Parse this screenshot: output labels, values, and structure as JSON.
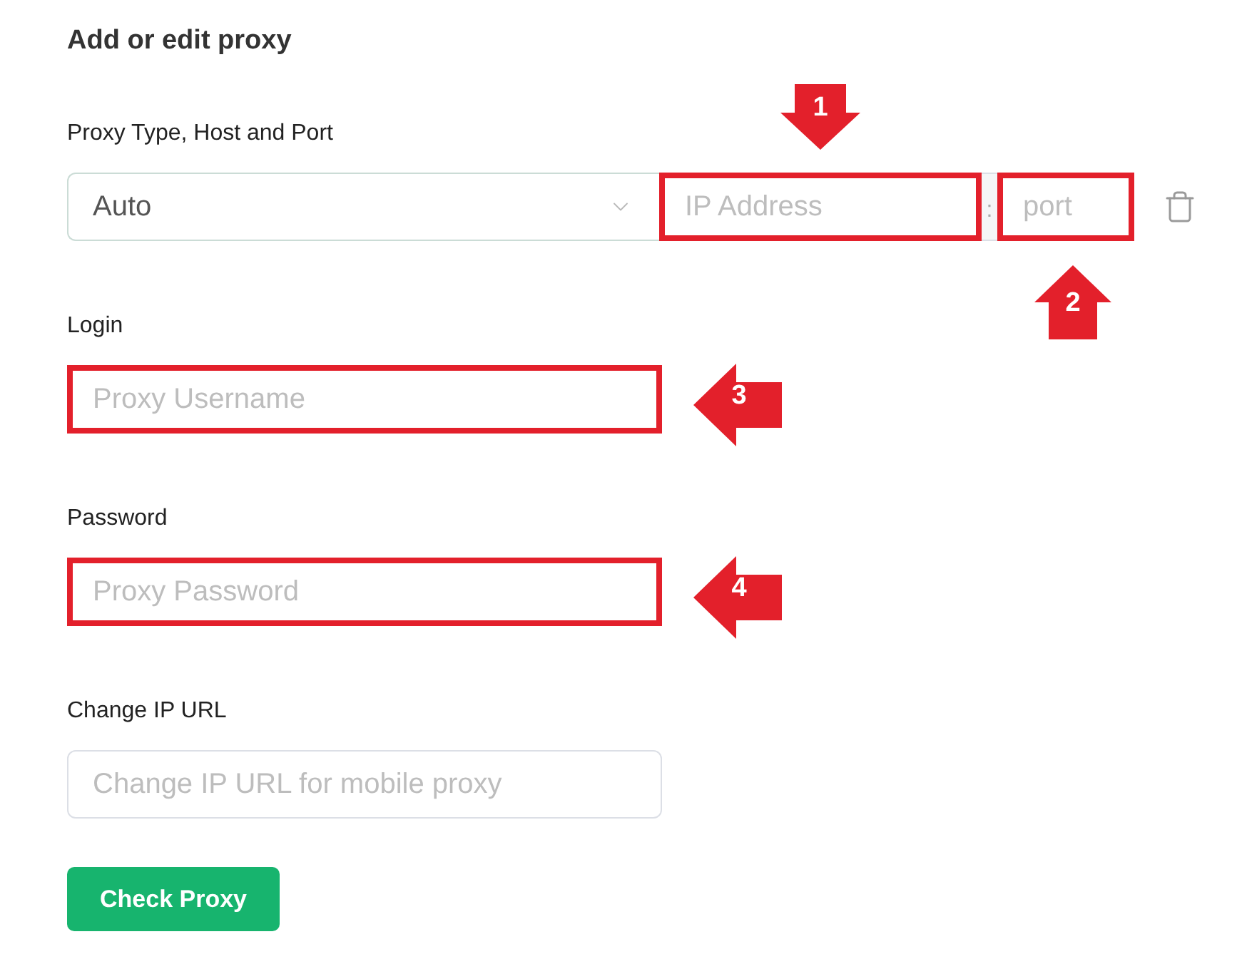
{
  "title": "Add or edit proxy",
  "sections": [
    {
      "kind": "host_port",
      "label": "Proxy Type, Host and Port",
      "proxy_type": {
        "value": "Auto"
      },
      "host": {
        "placeholder": "IP Address",
        "highlighted": true,
        "callout": {
          "number": "1",
          "kind": "down"
        }
      },
      "separator": ":",
      "port": {
        "placeholder": "port",
        "highlighted": true,
        "callout": {
          "number": "2",
          "kind": "up"
        }
      }
    },
    {
      "kind": "text",
      "label": "Login",
      "field": {
        "placeholder": "Proxy Username",
        "highlighted": true,
        "callout": {
          "number": "3",
          "kind": "left"
        }
      }
    },
    {
      "kind": "text",
      "label": "Password",
      "field": {
        "placeholder": "Proxy Password",
        "highlighted": true,
        "callout": {
          "number": "4",
          "kind": "left"
        }
      }
    },
    {
      "kind": "text",
      "label": "Change IP URL",
      "field": {
        "placeholder": "Change IP URL for mobile proxy",
        "highlighted": false
      }
    }
  ],
  "button": {
    "label": "Check Proxy"
  }
}
